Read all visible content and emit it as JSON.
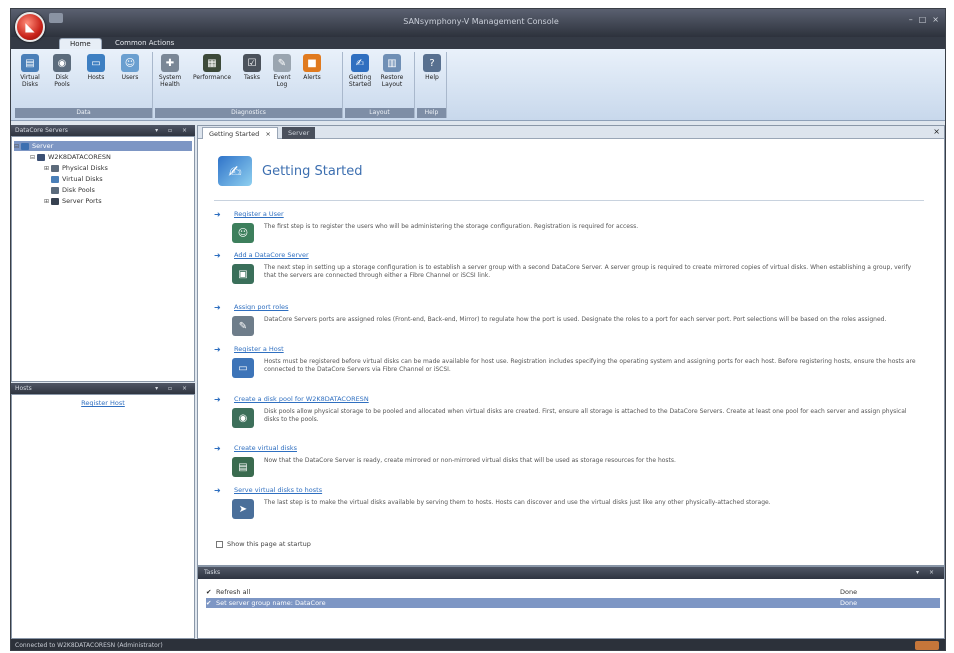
{
  "window": {
    "title": "SANsymphony-V Management Console",
    "controls": [
      "–",
      "□",
      "×"
    ]
  },
  "ribbon": {
    "tabs": [
      {
        "label": "Home",
        "active": true
      },
      {
        "label": "Common Actions",
        "active": false
      }
    ],
    "groups": [
      {
        "label": "Data",
        "buttons": [
          {
            "label": "Virtual Disks",
            "icon": "virtual-disk-icon",
            "color": "#4a7fb8"
          },
          {
            "label": "Disk Pools",
            "icon": "disk-pool-icon",
            "color": "#5b6b7c"
          },
          {
            "label": "Hosts",
            "icon": "host-icon",
            "color": "#3d7fc2"
          },
          {
            "label": "Users",
            "icon": "users-icon",
            "color": "#6a9fd0"
          }
        ]
      },
      {
        "label": "Diagnostics",
        "buttons": [
          {
            "label": "System Health",
            "icon": "health-icon",
            "color": "#7a8796"
          },
          {
            "label": "Performance",
            "icon": "performance-icon",
            "color": "#3d4a3a"
          },
          {
            "label": "Tasks",
            "icon": "tasks-icon",
            "color": "#4b525b"
          },
          {
            "label": "Event Log",
            "icon": "event-log-icon",
            "color": "#9aa5b0"
          },
          {
            "label": "Alerts",
            "icon": "alerts-icon",
            "color": "#e07a1f"
          }
        ]
      },
      {
        "label": "Layout",
        "buttons": [
          {
            "label": "Getting Started",
            "icon": "getting-started-icon",
            "color": "#2f6fc0"
          },
          {
            "label": "Restore Layout",
            "icon": "restore-layout-icon",
            "color": "#6f8fb5"
          }
        ]
      },
      {
        "label": "Help",
        "buttons": [
          {
            "label": "Help",
            "icon": "help-icon",
            "color": "#58708f"
          }
        ]
      }
    ]
  },
  "server_pane": {
    "title": "DataCore Servers",
    "tree": [
      {
        "label": "Server",
        "level": 0,
        "expander": "⊟",
        "selected": true,
        "icon": "server-group-icon",
        "color": "#3d6fb0"
      },
      {
        "label": "W2K8DATACORESN",
        "level": 1,
        "expander": "⊟",
        "selected": false,
        "icon": "server-icon",
        "color": "#3b4f73"
      },
      {
        "label": "Physical Disks",
        "level": 2,
        "expander": "⊞",
        "selected": false,
        "icon": "physical-disk-icon",
        "color": "#5d6b7b"
      },
      {
        "label": "Virtual Disks",
        "level": 2,
        "expander": "",
        "selected": false,
        "icon": "virtual-disk-icon",
        "color": "#4a7fb8"
      },
      {
        "label": "Disk Pools",
        "level": 2,
        "expander": "",
        "selected": false,
        "icon": "disk-pool-icon",
        "color": "#5b6b7c"
      },
      {
        "label": "Server Ports",
        "level": 2,
        "expander": "⊞",
        "selected": false,
        "icon": "port-icon",
        "color": "#374150"
      }
    ]
  },
  "hosts_pane": {
    "title": "Hosts",
    "link": "Register Host"
  },
  "document": {
    "tabs": [
      {
        "label": "Getting Started",
        "active": true,
        "close": "×"
      },
      {
        "label": "Server",
        "active": false
      }
    ],
    "close": "×",
    "heading": "Getting Started",
    "steps": [
      {
        "title": "Register a User",
        "icon": "register-user-icon",
        "color": "#3d7f5c",
        "text": "The first step is to register the users who will be administering the storage configuration. Registration is required for access."
      },
      {
        "title": "Add a DataCore Server",
        "icon": "add-server-icon",
        "color": "#3a6f5a",
        "text": "The next step in setting up a storage configuration is to establish a server group with a second DataCore Server. A server group is required to create mirrored copies of virtual disks. When establishing a group, verify that the servers are connected through either a Fibre Channel or iSCSI link."
      },
      {
        "title": "Assign port roles",
        "icon": "port-roles-icon",
        "color": "#6e7d8a",
        "text": "DataCore Servers ports are assigned roles (Front-end, Back-end, Mirror) to regulate how the port is used. Designate the roles to a port for each server port. Port selections will be based on the roles assigned."
      },
      {
        "title": "Register a Host",
        "icon": "register-host-icon",
        "color": "#3d74b8",
        "text": "Hosts must be registered before virtual disks can be made available for host use. Registration includes specifying the operating system and assigning ports for each host. Before registering hosts, ensure the hosts are connected to the DataCore Servers via Fibre Channel or iSCSI."
      },
      {
        "title": "Create a disk pool for W2K8DATACORESN",
        "icon": "create-pool-icon",
        "color": "#3d6f5a",
        "text": "Disk pools allow physical storage to be pooled and allocated when virtual disks are created. First, ensure all storage is attached to the DataCore Servers. Create at least one pool for each server and assign physical disks to the pools."
      },
      {
        "title": "Create virtual disks",
        "icon": "create-vdisk-icon",
        "color": "#3a6b4f",
        "text": "Now that the DataCore Server is ready, create mirrored or non-mirrored virtual disks that will be used as storage resources for the hosts."
      },
      {
        "title": "Serve virtual disks to hosts",
        "icon": "serve-disks-icon",
        "color": "#4a6f9a",
        "text": "The last step is to make the virtual disks available by serving them to hosts. Hosts can discover and use the virtual disks just like any other physically-attached storage."
      }
    ],
    "show_on_startup": "Show this page at startup"
  },
  "tasks_panel": {
    "title": "Tasks",
    "rows": [
      {
        "name": "Refresh all",
        "status": "Done",
        "selected": false
      },
      {
        "name": "Set server group name: DataCore",
        "status": "Done",
        "selected": true
      }
    ]
  },
  "statusbar": {
    "text": "Connected to W2K8DATACORESN (Administrator)"
  }
}
